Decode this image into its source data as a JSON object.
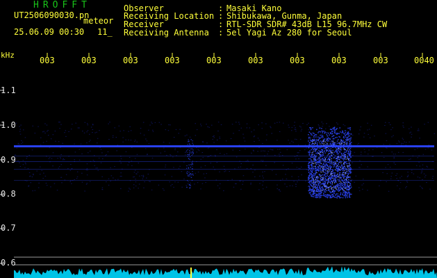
{
  "header": {
    "title": "HROFFT",
    "filename": "UT2506090030.pn",
    "mode": "meteor",
    "datetime": "25.06.09 00:30",
    "count": "11_",
    "info": [
      {
        "label": "Observer",
        "value": "Masaki Kano"
      },
      {
        "label": "Receiving Location",
        "value": "Shibukawa, Gunma, Japan"
      },
      {
        "label": "Receiver",
        "value": "RTL-SDR SDR# 43dB L15 96.7MHz CW"
      },
      {
        "label": "Receiving Antenna",
        "value": "5el Yagi Az 280 for Seoul"
      }
    ]
  },
  "axes": {
    "unit": "kHz",
    "freq_labels": [
      "1.1",
      "1.0",
      "0.9",
      "0.8",
      "0.7",
      "0.6"
    ],
    "time_labels": [
      "003",
      "003",
      "003",
      "003",
      "003",
      "003",
      "003",
      "003",
      "003",
      "0040"
    ]
  },
  "colors": {
    "header_text": "#ffff3a",
    "title": "#19c519",
    "signal": "#2b45ff",
    "level": "#00d8ff",
    "grid_yellow": "#ffff3a"
  }
}
